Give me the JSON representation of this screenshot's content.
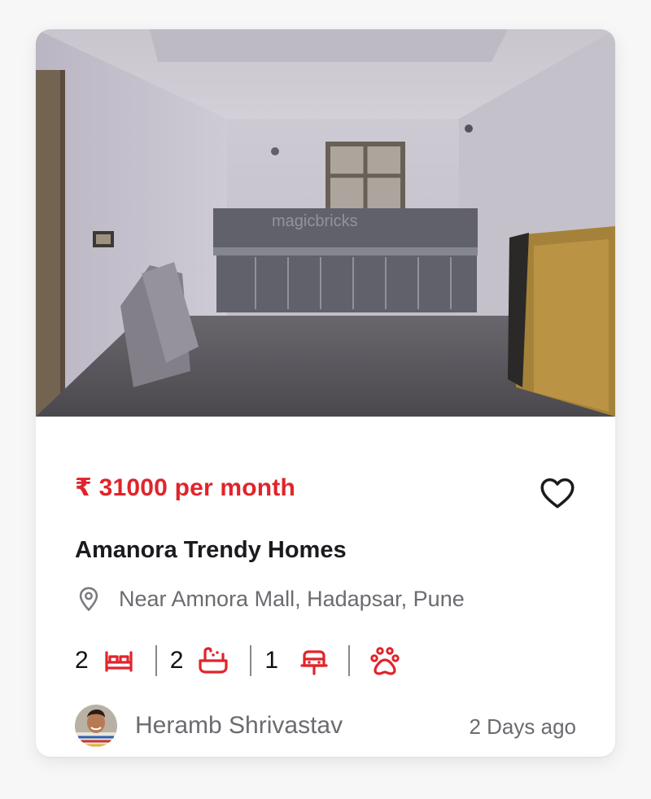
{
  "listing": {
    "price": "₹ 31000 per month",
    "title": "Amanora Trendy Homes",
    "location": "Near Amnora Mall, Hadapsar, Pune",
    "amenities": {
      "bedrooms": "2",
      "bathrooms": "2",
      "parking": "1"
    },
    "agent_name": "Heramb Shrivastav",
    "posted": "2 Days ago",
    "photo_watermark": "magicbricks"
  },
  "colors": {
    "accent": "#e0242b",
    "title": "#1b1b1f",
    "muted": "#6b6b70",
    "card": "#ffffff",
    "background": "#f7f7f8"
  },
  "icons": [
    "heart-icon",
    "location-pin-icon",
    "bed-icon",
    "bathtub-icon",
    "car-icon",
    "paw-icon"
  ]
}
